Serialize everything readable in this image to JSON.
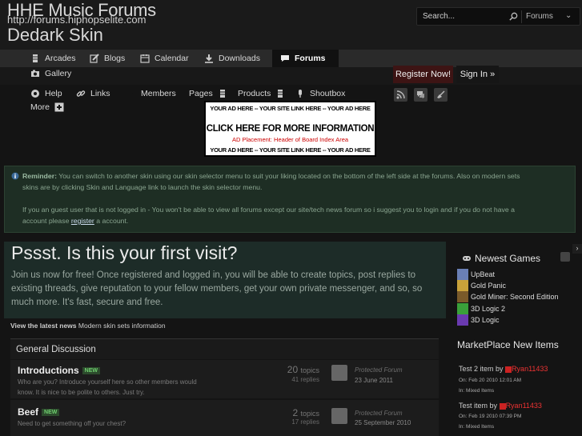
{
  "header": {
    "logo_line1": "HHE Music Forums",
    "logo_line2": "http://forums.hiphopselite.com",
    "logo_line3": "Dedark Skin",
    "search_placeholder": "Search...",
    "search_scope": "Forums"
  },
  "nav": {
    "row1": [
      {
        "label": "Arcades",
        "icon": "trophy-icon"
      },
      {
        "label": "Blogs",
        "icon": "pencil-icon"
      },
      {
        "label": "Calendar",
        "icon": "calendar-icon"
      },
      {
        "label": "Downloads",
        "icon": "download-icon"
      },
      {
        "label": "Forums",
        "icon": "chat-bubble-icon"
      }
    ],
    "row2": [
      {
        "label": "Gallery",
        "icon": "camera-icon"
      }
    ],
    "row3": [
      {
        "label": "Help",
        "icon": "help-icon"
      },
      {
        "label": "Links",
        "icon": "link-icon"
      },
      {
        "label": "Members",
        "icon": ""
      },
      {
        "label": "Pages",
        "icon": "trophy-icon"
      },
      {
        "label": "Products",
        "icon": "trophy-icon"
      },
      {
        "label": "Shoutbox",
        "icon": "microphone-icon"
      }
    ],
    "more_label": "More"
  },
  "auth": {
    "register_label": "Register Now!",
    "signin_label": "Sign In »"
  },
  "ad": {
    "line1": "YOUR AD HERE -- YOUR SITE LINK HERE -- YOUR AD HERE",
    "line2": "CLICK HERE FOR MORE INFORMATION",
    "line3": "AD Placement: Header of Board Index Area",
    "line4": "YOUR AD HERE -- YOUR SITE LINK HERE -- YOUR AD HERE"
  },
  "notice": {
    "reminder_label": "Reminder:",
    "line1": "You can switch to another skin using our skin selector menu to suit your liking located on the bottom of the left side at the forums. Also on modern sets",
    "line2": "skins are by clicking Skin and Language link to launch the skin selector menu.",
    "line3": "If you an guest user that is not logged in - You won't be able to view all forums except our site/tech news forum so i suggest you to login and if you do not have a",
    "line4_pre": "account please ",
    "line4_link": "register",
    "line4_post": " a account."
  },
  "welcome": {
    "title": "Pssst. Is this your first visit?",
    "line1": "Join us now for free! Once registered and logged in, you will be able to create topics, post replies to",
    "line2": "existing threads, give reputation to your fellow members, get your own private messenger, and so, so",
    "line3": "much more. It's fast, secure and free."
  },
  "latest_news": {
    "label": "View the latest news",
    "text": "Modern skin sets information"
  },
  "category": {
    "title": "General Discussion",
    "forums": [
      {
        "name": "Introductions",
        "badge": "NEW",
        "desc1": "Who are you? Introduce yourself here so other members would",
        "desc2": "know. It is nice to be polite to others. Just try.",
        "topics_num": "20",
        "topics_label": "topics",
        "replies": "41 replies",
        "last_title": "Protected Forum",
        "last_date": "23 June 2011"
      },
      {
        "name": "Beef",
        "badge": "NEW",
        "desc1": "Need to get something off your chest?",
        "desc2": "",
        "topics_num": "2",
        "topics_label": "topics",
        "replies": "17 replies",
        "last_title": "Protected Forum",
        "last_date": "25 September 2010"
      }
    ]
  },
  "sidebar": {
    "toggle": "›",
    "games_title": "Newest Games",
    "games": [
      {
        "name": "UpBeat",
        "color": "#6a7fb5"
      },
      {
        "name": "Gold Panic",
        "color": "#c9a23a"
      },
      {
        "name": "Gold Miner: Second Edition",
        "color": "#7a5a2a"
      },
      {
        "name": "3D Logic 2",
        "color": "#3aa03a"
      },
      {
        "name": "3D Logic",
        "color": "#6a3ab0"
      }
    ],
    "market_title": "MarketPlace New Items",
    "market": [
      {
        "title": "Test 2 item",
        "by": "by",
        "user": "Ryan11433",
        "date": "On: Feb 20 2010 12:01 AM",
        "in": "In: Mixed Items"
      },
      {
        "title": "Test item",
        "by": "by",
        "user": "Ryan11433",
        "date": "On: Feb 19 2010 07:39 PM",
        "in": "In: Mixed Items"
      }
    ]
  },
  "colors": {
    "register_bg": "#3d1414",
    "notice_bg": "#1e2e24",
    "welcome_bg": "#1d2c28",
    "new_badge": "#6fcf6f",
    "market_user": "#e33333"
  }
}
